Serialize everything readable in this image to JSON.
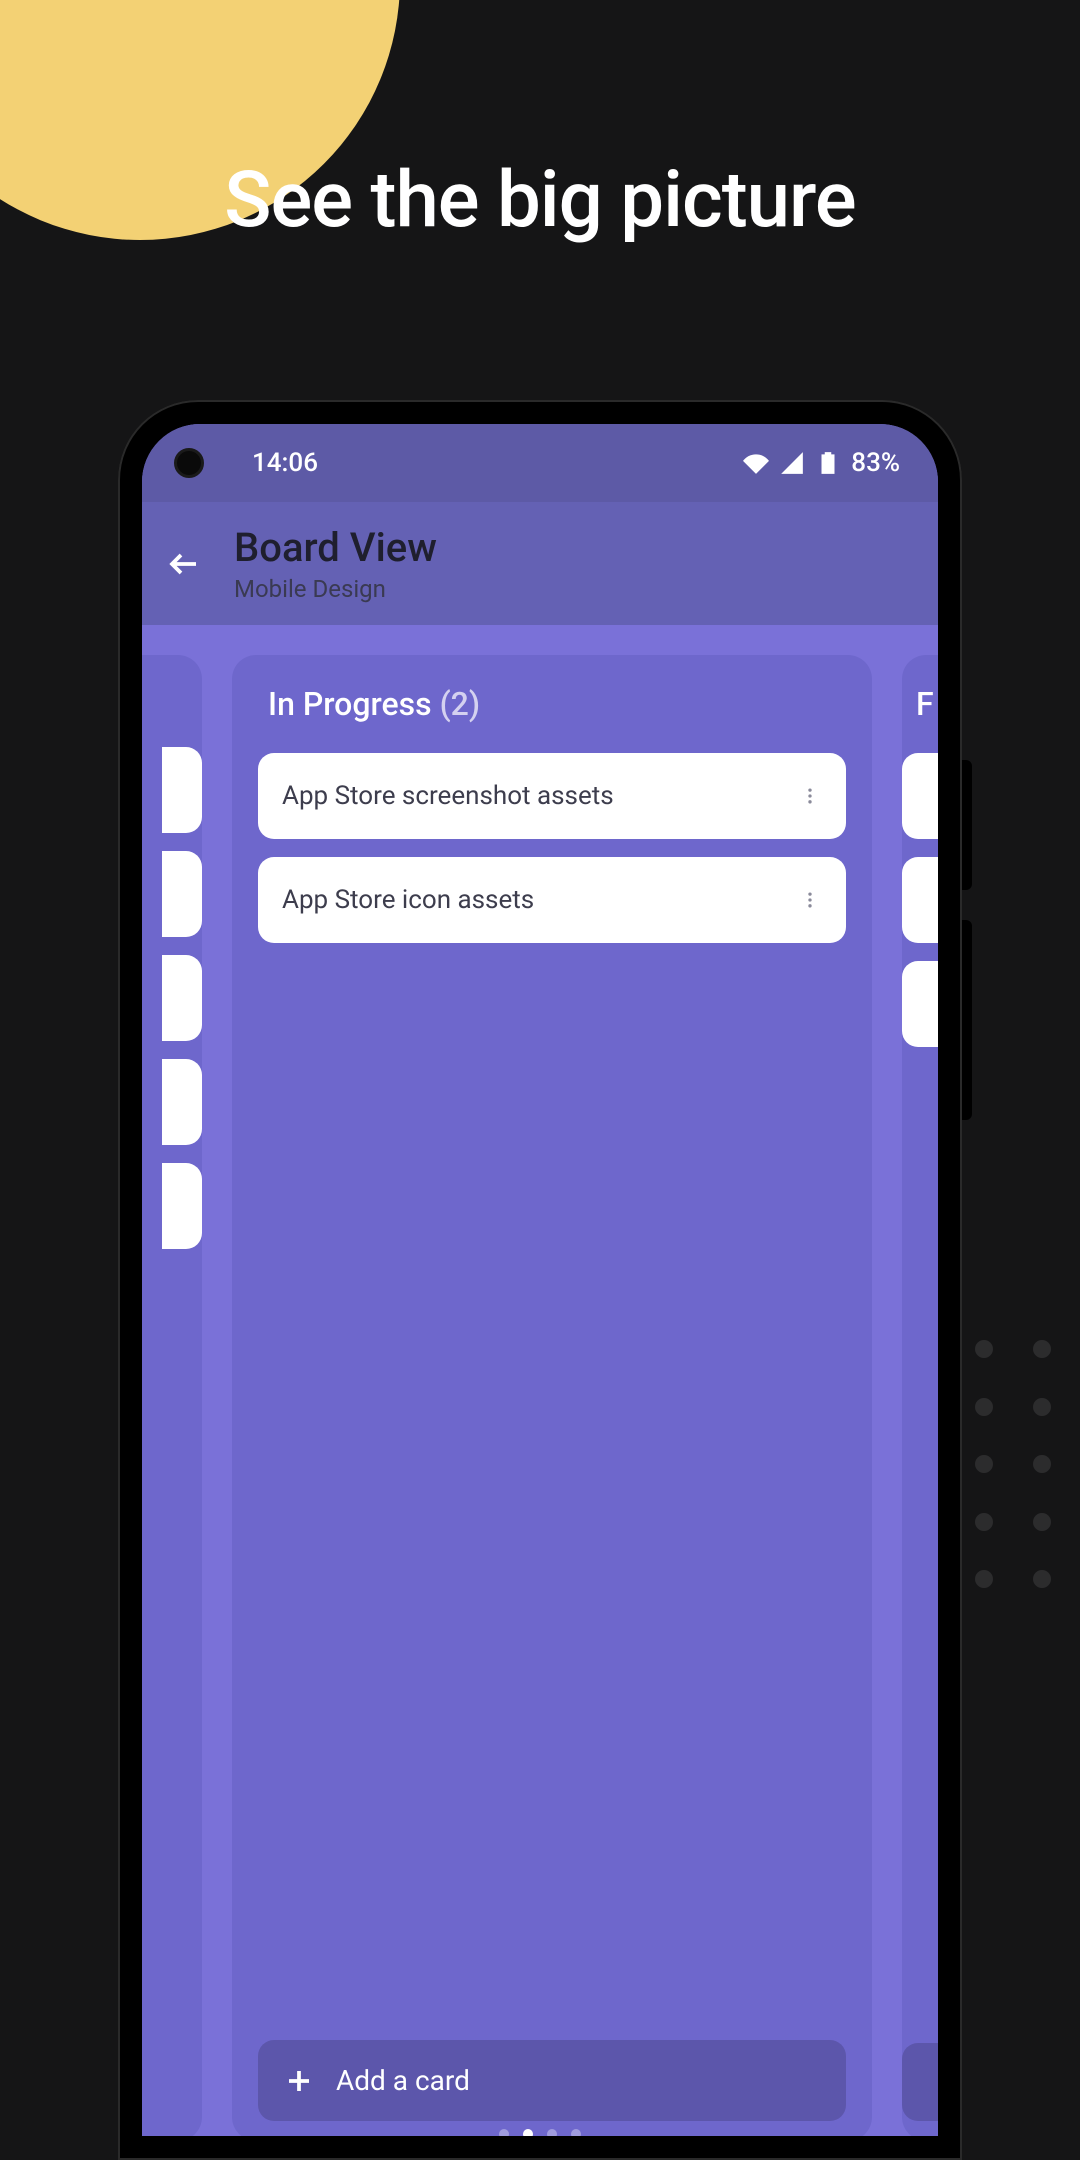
{
  "headline": "See the big picture",
  "status": {
    "time": "14:06",
    "battery": "83%"
  },
  "appbar": {
    "title": "Board View",
    "subtitle": "Mobile Design"
  },
  "columns": {
    "center": {
      "name": "In Progress",
      "count": "(2)",
      "cards": [
        {
          "title": "App Store screenshot assets"
        },
        {
          "title": "App Store icon assets"
        }
      ],
      "add_label": "Add a card"
    },
    "right": {
      "initial": "F"
    }
  },
  "pager": {
    "count": 4,
    "active": 1
  }
}
